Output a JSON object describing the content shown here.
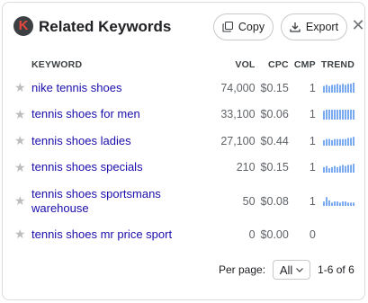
{
  "header": {
    "logo_letter": "K",
    "title": "Related Keywords",
    "copy_label": "Copy",
    "export_label": "Export",
    "close_label": "✕"
  },
  "table": {
    "columns": {
      "keyword": "KEYWORD",
      "vol": "VOL",
      "cpc": "CPC",
      "cmp": "CMP",
      "trend": "TREND"
    },
    "rows": [
      {
        "keyword": "nike tennis shoes",
        "vol": "74,000",
        "cpc": "$0.15",
        "cmp": "1",
        "trend": [
          6,
          7,
          6,
          7,
          7,
          8,
          7,
          8,
          7,
          8,
          8,
          9
        ]
      },
      {
        "keyword": "tennis shoes for men",
        "vol": "33,100",
        "cpc": "$0.06",
        "cmp": "1",
        "trend": [
          8,
          9,
          9,
          9,
          9,
          9,
          9,
          9,
          9,
          9,
          9,
          9
        ]
      },
      {
        "keyword": "tennis shoes ladies",
        "vol": "27,100",
        "cpc": "$0.44",
        "cmp": "1",
        "trend": [
          5,
          6,
          6,
          5,
          6,
          6,
          6,
          6,
          6,
          7,
          7,
          8
        ]
      },
      {
        "keyword": "tennis shoes specials",
        "vol": "210",
        "cpc": "$0.15",
        "cmp": "1",
        "trend": [
          5,
          6,
          4,
          5,
          6,
          5,
          6,
          7,
          6,
          7,
          7,
          8
        ]
      },
      {
        "keyword": "tennis shoes sportsmans warehouse",
        "vol": "50",
        "cpc": "$0.08",
        "cmp": "1",
        "trend": [
          4,
          8,
          5,
          3,
          4,
          4,
          3,
          4,
          4,
          3,
          3,
          3
        ]
      },
      {
        "keyword": "tennis shoes mr price sport",
        "vol": "0",
        "cpc": "$0.00",
        "cmp": "0",
        "trend": []
      }
    ]
  },
  "footer": {
    "per_page_label": "Per page:",
    "per_page_value": "All",
    "range_text": "1-6 of 6"
  },
  "colors": {
    "link": "#1a0dab",
    "trend_bar": "#7aaaf0",
    "logo_bg": "#3c4043",
    "logo_letter": "#e8453c"
  }
}
